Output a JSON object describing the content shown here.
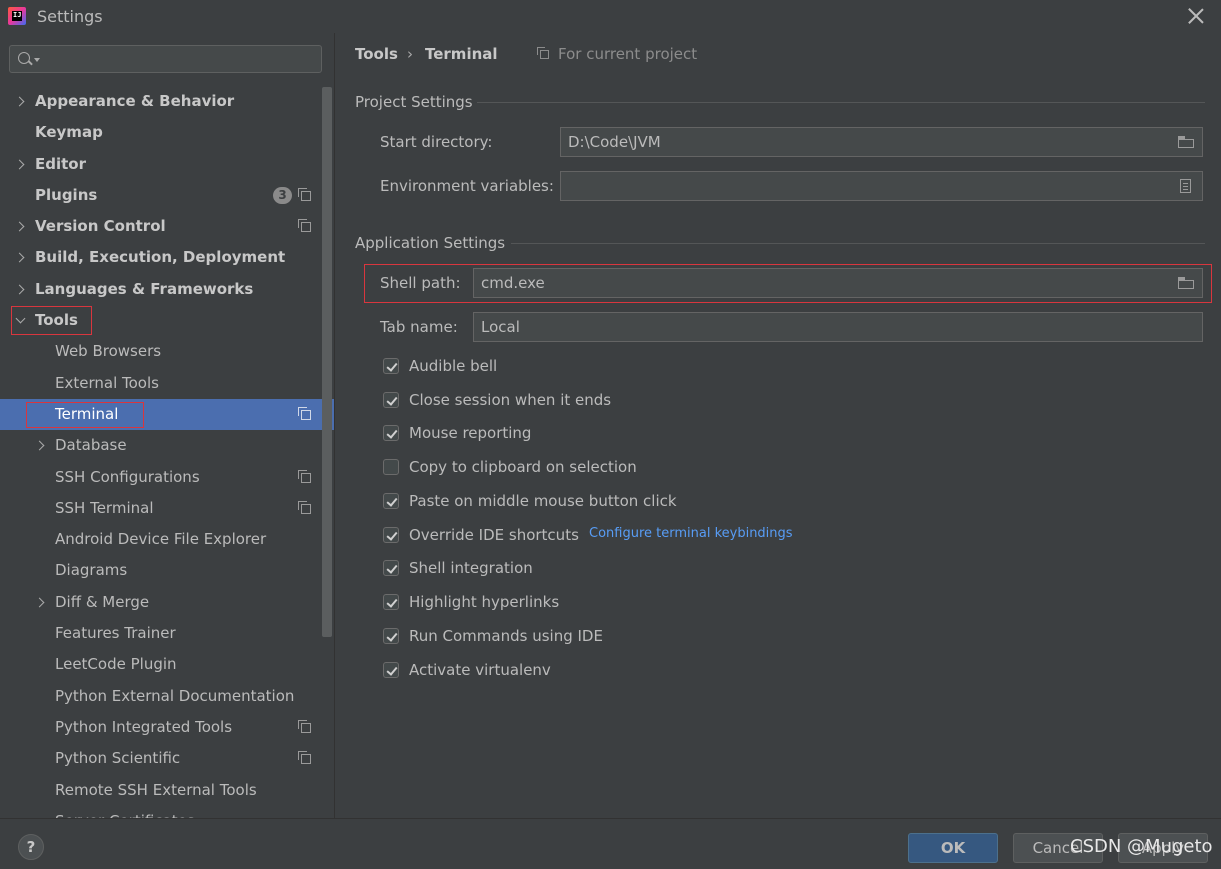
{
  "window": {
    "title": "Settings"
  },
  "sidebar": {
    "search_placeholder": "",
    "items": [
      {
        "label": "Appearance & Behavior"
      },
      {
        "label": "Keymap"
      },
      {
        "label": "Editor"
      },
      {
        "label": "Plugins",
        "badge": "3"
      },
      {
        "label": "Version Control"
      },
      {
        "label": "Build, Execution, Deployment"
      },
      {
        "label": "Languages & Frameworks"
      },
      {
        "label": "Tools"
      },
      {
        "label": "Web Browsers"
      },
      {
        "label": "External Tools"
      },
      {
        "label": "Terminal"
      },
      {
        "label": "Database"
      },
      {
        "label": "SSH Configurations"
      },
      {
        "label": "SSH Terminal"
      },
      {
        "label": "Android Device File Explorer"
      },
      {
        "label": "Diagrams"
      },
      {
        "label": "Diff & Merge"
      },
      {
        "label": "Features Trainer"
      },
      {
        "label": "LeetCode Plugin"
      },
      {
        "label": "Python External Documentation"
      },
      {
        "label": "Python Integrated Tools"
      },
      {
        "label": "Python Scientific"
      },
      {
        "label": "Remote SSH External Tools"
      },
      {
        "label": "Server Certificates"
      }
    ]
  },
  "main": {
    "breadcrumb": {
      "parent": "Tools",
      "separator": "›",
      "current": "Terminal"
    },
    "scope": "For current project",
    "project_settings": {
      "title": "Project Settings",
      "start_directory_label": "Start directory:",
      "start_directory_value": "D:\\Code\\JVM",
      "env_vars_label": "Environment variables:",
      "env_vars_value": ""
    },
    "application_settings": {
      "title": "Application Settings",
      "shell_path_label": "Shell path:",
      "shell_path_value": "cmd.exe",
      "tab_name_label": "Tab name:",
      "tab_name_value": "Local",
      "checkboxes": [
        {
          "label": "Audible bell",
          "checked": true
        },
        {
          "label": "Close session when it ends",
          "checked": true
        },
        {
          "label": "Mouse reporting",
          "checked": true
        },
        {
          "label": "Copy to clipboard on selection",
          "checked": false
        },
        {
          "label": "Paste on middle mouse button click",
          "checked": true
        },
        {
          "label": "Override IDE shortcuts",
          "checked": true
        },
        {
          "label": "Shell integration",
          "checked": true
        },
        {
          "label": "Highlight hyperlinks",
          "checked": true
        },
        {
          "label": "Run Commands using IDE",
          "checked": true
        },
        {
          "label": "Activate virtualenv",
          "checked": true
        }
      ],
      "keybindings_link": "Configure terminal keybindings"
    }
  },
  "footer": {
    "help": "?",
    "ok": "OK",
    "cancel": "Cancel",
    "apply": "Apply",
    "watermark": "CSDN @Mugeto"
  },
  "colors": {
    "background": "#3c3f41",
    "selection": "#4b6eaf",
    "highlight_box": "#d9363e",
    "link": "#589df6",
    "ok_button": "#365880"
  }
}
